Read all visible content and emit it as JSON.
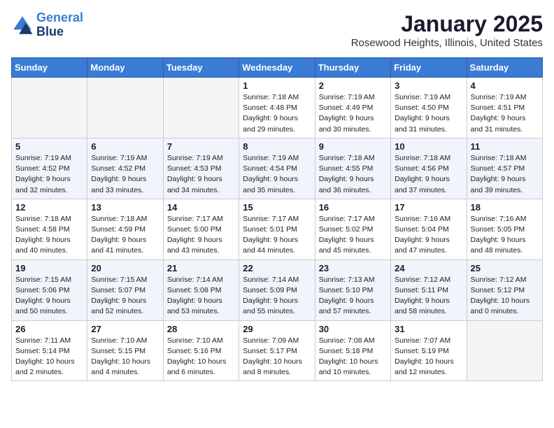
{
  "header": {
    "logo_line1": "General",
    "logo_line2": "Blue",
    "month": "January 2025",
    "location": "Rosewood Heights, Illinois, United States"
  },
  "weekdays": [
    "Sunday",
    "Monday",
    "Tuesday",
    "Wednesday",
    "Thursday",
    "Friday",
    "Saturday"
  ],
  "weeks": [
    [
      {
        "day": "",
        "info": ""
      },
      {
        "day": "",
        "info": ""
      },
      {
        "day": "",
        "info": ""
      },
      {
        "day": "1",
        "info": "Sunrise: 7:18 AM\nSunset: 4:48 PM\nDaylight: 9 hours\nand 29 minutes."
      },
      {
        "day": "2",
        "info": "Sunrise: 7:19 AM\nSunset: 4:49 PM\nDaylight: 9 hours\nand 30 minutes."
      },
      {
        "day": "3",
        "info": "Sunrise: 7:19 AM\nSunset: 4:50 PM\nDaylight: 9 hours\nand 31 minutes."
      },
      {
        "day": "4",
        "info": "Sunrise: 7:19 AM\nSunset: 4:51 PM\nDaylight: 9 hours\nand 31 minutes."
      }
    ],
    [
      {
        "day": "5",
        "info": "Sunrise: 7:19 AM\nSunset: 4:52 PM\nDaylight: 9 hours\nand 32 minutes."
      },
      {
        "day": "6",
        "info": "Sunrise: 7:19 AM\nSunset: 4:52 PM\nDaylight: 9 hours\nand 33 minutes."
      },
      {
        "day": "7",
        "info": "Sunrise: 7:19 AM\nSunset: 4:53 PM\nDaylight: 9 hours\nand 34 minutes."
      },
      {
        "day": "8",
        "info": "Sunrise: 7:19 AM\nSunset: 4:54 PM\nDaylight: 9 hours\nand 35 minutes."
      },
      {
        "day": "9",
        "info": "Sunrise: 7:18 AM\nSunset: 4:55 PM\nDaylight: 9 hours\nand 36 minutes."
      },
      {
        "day": "10",
        "info": "Sunrise: 7:18 AM\nSunset: 4:56 PM\nDaylight: 9 hours\nand 37 minutes."
      },
      {
        "day": "11",
        "info": "Sunrise: 7:18 AM\nSunset: 4:57 PM\nDaylight: 9 hours\nand 39 minutes."
      }
    ],
    [
      {
        "day": "12",
        "info": "Sunrise: 7:18 AM\nSunset: 4:58 PM\nDaylight: 9 hours\nand 40 minutes."
      },
      {
        "day": "13",
        "info": "Sunrise: 7:18 AM\nSunset: 4:59 PM\nDaylight: 9 hours\nand 41 minutes."
      },
      {
        "day": "14",
        "info": "Sunrise: 7:17 AM\nSunset: 5:00 PM\nDaylight: 9 hours\nand 43 minutes."
      },
      {
        "day": "15",
        "info": "Sunrise: 7:17 AM\nSunset: 5:01 PM\nDaylight: 9 hours\nand 44 minutes."
      },
      {
        "day": "16",
        "info": "Sunrise: 7:17 AM\nSunset: 5:02 PM\nDaylight: 9 hours\nand 45 minutes."
      },
      {
        "day": "17",
        "info": "Sunrise: 7:16 AM\nSunset: 5:04 PM\nDaylight: 9 hours\nand 47 minutes."
      },
      {
        "day": "18",
        "info": "Sunrise: 7:16 AM\nSunset: 5:05 PM\nDaylight: 9 hours\nand 48 minutes."
      }
    ],
    [
      {
        "day": "19",
        "info": "Sunrise: 7:15 AM\nSunset: 5:06 PM\nDaylight: 9 hours\nand 50 minutes."
      },
      {
        "day": "20",
        "info": "Sunrise: 7:15 AM\nSunset: 5:07 PM\nDaylight: 9 hours\nand 52 minutes."
      },
      {
        "day": "21",
        "info": "Sunrise: 7:14 AM\nSunset: 5:08 PM\nDaylight: 9 hours\nand 53 minutes."
      },
      {
        "day": "22",
        "info": "Sunrise: 7:14 AM\nSunset: 5:09 PM\nDaylight: 9 hours\nand 55 minutes."
      },
      {
        "day": "23",
        "info": "Sunrise: 7:13 AM\nSunset: 5:10 PM\nDaylight: 9 hours\nand 57 minutes."
      },
      {
        "day": "24",
        "info": "Sunrise: 7:12 AM\nSunset: 5:11 PM\nDaylight: 9 hours\nand 58 minutes."
      },
      {
        "day": "25",
        "info": "Sunrise: 7:12 AM\nSunset: 5:12 PM\nDaylight: 10 hours\nand 0 minutes."
      }
    ],
    [
      {
        "day": "26",
        "info": "Sunrise: 7:11 AM\nSunset: 5:14 PM\nDaylight: 10 hours\nand 2 minutes."
      },
      {
        "day": "27",
        "info": "Sunrise: 7:10 AM\nSunset: 5:15 PM\nDaylight: 10 hours\nand 4 minutes."
      },
      {
        "day": "28",
        "info": "Sunrise: 7:10 AM\nSunset: 5:16 PM\nDaylight: 10 hours\nand 6 minutes."
      },
      {
        "day": "29",
        "info": "Sunrise: 7:09 AM\nSunset: 5:17 PM\nDaylight: 10 hours\nand 8 minutes."
      },
      {
        "day": "30",
        "info": "Sunrise: 7:08 AM\nSunset: 5:18 PM\nDaylight: 10 hours\nand 10 minutes."
      },
      {
        "day": "31",
        "info": "Sunrise: 7:07 AM\nSunset: 5:19 PM\nDaylight: 10 hours\nand 12 minutes."
      },
      {
        "day": "",
        "info": ""
      }
    ]
  ]
}
